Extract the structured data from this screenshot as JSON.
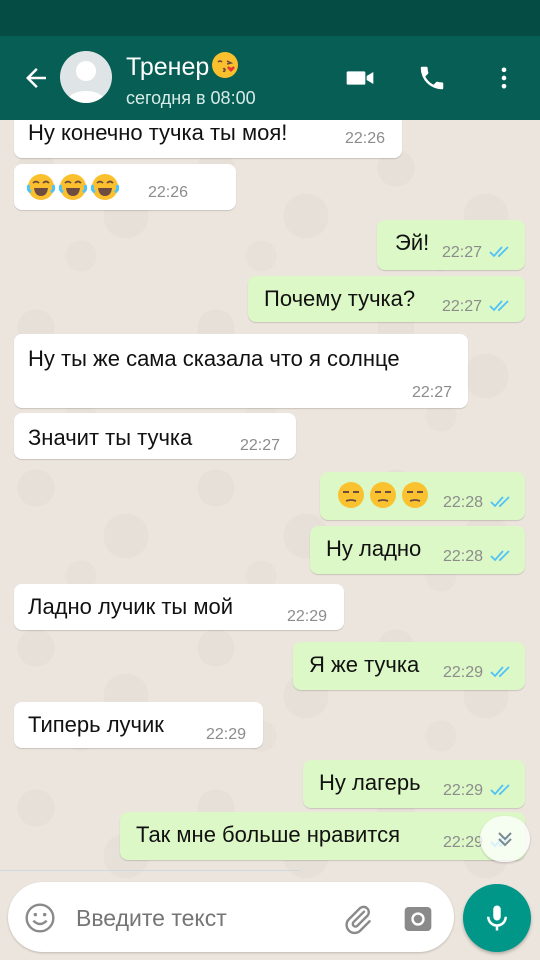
{
  "header": {
    "contact_name": "Тренер",
    "name_emoji_icon": "face-blowing-kiss-icon",
    "status": "сегодня в 08:00",
    "icons": [
      "back-arrow-icon",
      "video-call-icon",
      "phone-icon",
      "more-vert-icon"
    ]
  },
  "messages": [
    {
      "dir": "in",
      "text": "Ну конечно тучка ты моя!",
      "time": "22:26"
    },
    {
      "dir": "in",
      "emoji": "face-with-tears-of-joy",
      "emoji_count": 3,
      "time": "22:26"
    },
    {
      "dir": "out",
      "text": "Эй!",
      "time": "22:27",
      "status": "read"
    },
    {
      "dir": "out",
      "text": "Почему тучка?",
      "time": "22:27",
      "status": "read"
    },
    {
      "dir": "in",
      "text": "Ну ты же сама сказала что я солнце",
      "time": "22:27"
    },
    {
      "dir": "in",
      "text": "Значит ты тучка",
      "time": "22:27"
    },
    {
      "dir": "out",
      "emoji": "unamused-face",
      "emoji_count": 3,
      "time": "22:28",
      "status": "read"
    },
    {
      "dir": "out",
      "text": "Ну ладно",
      "time": "22:28",
      "status": "read"
    },
    {
      "dir": "in",
      "text": "Ладно лучик ты мой",
      "time": "22:29"
    },
    {
      "dir": "out",
      "text": "Я же тучка",
      "time": "22:29",
      "status": "read"
    },
    {
      "dir": "in",
      "text": "Типерь лучик",
      "time": "22:29"
    },
    {
      "dir": "out",
      "text": "Ну лагерь",
      "time": "22:29",
      "status": "read"
    },
    {
      "dir": "out",
      "text": "Так мне больше нравится",
      "time": "22:29",
      "status": "read"
    }
  ],
  "input": {
    "placeholder": "Введите текст",
    "icons": [
      "emoji-icon",
      "attach-icon",
      "camera-icon",
      "mic-icon"
    ]
  },
  "scroll_down_icon": "chevron-double-down-icon",
  "colors": {
    "header": "#075e54",
    "statusbar": "#054d44",
    "incoming_bubble": "#ffffff",
    "outgoing_bubble": "#dcf8c6",
    "read_ticks": "#4fc3f7",
    "accent": "#009688"
  }
}
